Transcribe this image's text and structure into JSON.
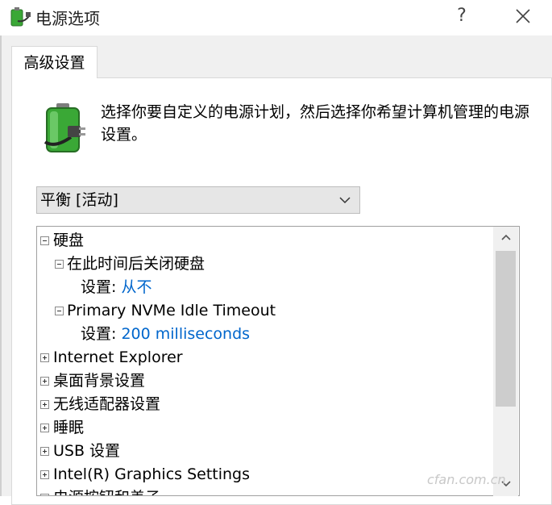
{
  "window": {
    "title": "电源选项",
    "help_label": "?",
    "close_icon": "close-icon"
  },
  "tab": {
    "label": "高级设置"
  },
  "description": "选择你要自定义的电源计划，然后选择你希望计算机管理的电源设置。",
  "plan_select": {
    "value": "平衡 [活动]"
  },
  "tree": {
    "items": [
      {
        "label": "硬盘",
        "expanded": true
      },
      {
        "label": "在此时间后关闭硬盘",
        "expanded": true
      },
      {
        "setting_label": "设置:",
        "value": "从不"
      },
      {
        "label": "Primary NVMe Idle Timeout",
        "expanded": true
      },
      {
        "setting_label": "设置:",
        "value": "200 milliseconds"
      },
      {
        "label": "Internet Explorer",
        "expanded": false
      },
      {
        "label": "桌面背景设置",
        "expanded": false
      },
      {
        "label": "无线适配器设置",
        "expanded": false
      },
      {
        "label": "睡眠",
        "expanded": false
      },
      {
        "label": "USB 设置",
        "expanded": false
      },
      {
        "label": "Intel(R) Graphics Settings",
        "expanded": false
      },
      {
        "label": "电源按钮和盖子",
        "expanded": false
      }
    ]
  },
  "watermark": "cfan.com.cn",
  "colors": {
    "value_text": "#0066cc",
    "battery_green": "#3aa836"
  }
}
